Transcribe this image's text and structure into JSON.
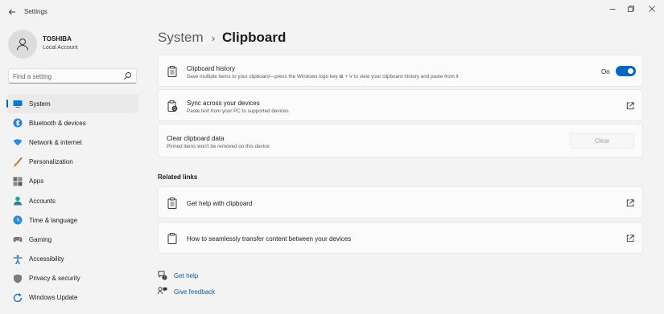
{
  "window": {
    "title": "Settings"
  },
  "profile": {
    "name": "TOSHIBA",
    "account_type": "Local Account"
  },
  "search": {
    "placeholder": "Find a setting"
  },
  "sidebar": {
    "items": [
      {
        "label": "System",
        "icon": "monitor-icon",
        "active": true
      },
      {
        "label": "Bluetooth & devices",
        "icon": "bluetooth-icon"
      },
      {
        "label": "Network & internet",
        "icon": "wifi-icon"
      },
      {
        "label": "Personalization",
        "icon": "brush-icon"
      },
      {
        "label": "Apps",
        "icon": "apps-icon"
      },
      {
        "label": "Accounts",
        "icon": "person-icon"
      },
      {
        "label": "Time & language",
        "icon": "globe-clock-icon"
      },
      {
        "label": "Gaming",
        "icon": "gamepad-icon"
      },
      {
        "label": "Accessibility",
        "icon": "accessibility-icon"
      },
      {
        "label": "Privacy & security",
        "icon": "shield-icon"
      },
      {
        "label": "Windows Update",
        "icon": "update-icon"
      }
    ]
  },
  "breadcrumb": {
    "parent": "System",
    "separator": "›",
    "current": "Clipboard"
  },
  "settings": {
    "history": {
      "title": "Clipboard history",
      "subtitle": "Save multiple items to your clipboard—press the Windows logo key ⊞ + V to view your clipboard history and paste from it",
      "toggle_label": "On",
      "toggle_on": true
    },
    "sync": {
      "title": "Sync across your devices",
      "subtitle": "Paste text from your PC to supported devices"
    },
    "clear": {
      "title": "Clear clipboard data",
      "subtitle": "Pinned items won't be removed on this device",
      "button_label": "Clear"
    }
  },
  "related": {
    "heading": "Related links",
    "links": [
      {
        "label": "Get help with clipboard"
      },
      {
        "label": "How to seamlessly transfer content between your devices"
      }
    ]
  },
  "help": {
    "get_help": "Get help",
    "give_feedback": "Give feedback"
  },
  "colors": {
    "accent": "#0067c0",
    "background": "#f3f3f3",
    "card": "#fbfbfb"
  }
}
